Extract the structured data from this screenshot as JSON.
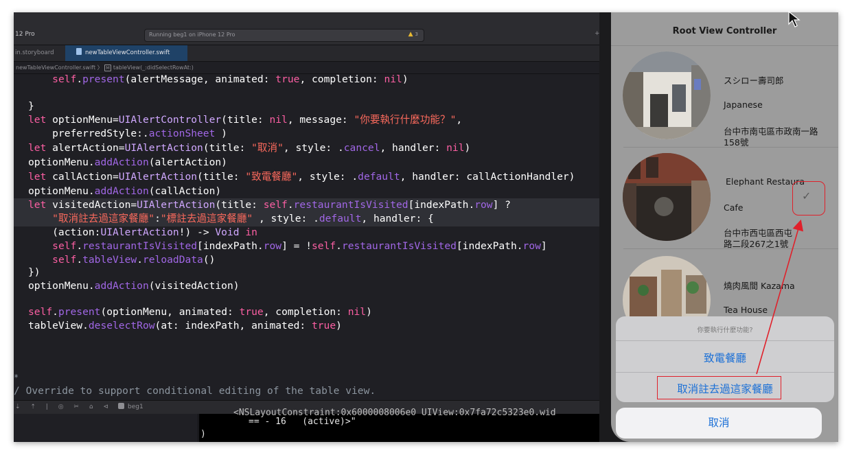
{
  "xcode": {
    "scheme": "12 Pro",
    "status": "Running beg1 on iPhone 12 Pro",
    "warning_count": "3",
    "add_label": "+",
    "tabs": [
      {
        "label": "in.storyboard"
      },
      {
        "label": "newTableViewController.swift"
      }
    ],
    "jumpbar": {
      "file": "newTableViewController.swift",
      "separator": "〉",
      "badge": "M",
      "method": "tableView(_:didSelectRowAt:)"
    },
    "gutter_mark": "*",
    "debug_target": "beg1",
    "debug_icons": "⇣ ⇡ | ◎ ✂ ⌂ ⊲",
    "console": {
      "clipped": "<NSLayoutConstraint:0x6000008006e0 UIView:0x7fa72c5323e0.wid",
      "line1": "== - 16   (active)>\"",
      "line2": ")"
    }
  },
  "simulator": {
    "nav_title": "Root View Controller",
    "rows": [
      {
        "name": "スシロー壽司郎",
        "type": "Japanese",
        "location": "台中市南屯區市政南一路158號"
      },
      {
        "name": "Elephant Restaura",
        "type": "Cafe",
        "location": "台中市西屯區西屯路二段267之1號",
        "checked": true
      },
      {
        "name": "燒肉風間 Kazama",
        "type": "Tea House",
        "location": ""
      }
    ],
    "checkmark": "✓",
    "action_sheet": {
      "message": "你要執行什麼功能?",
      "actions": [
        "致電餐廳",
        "取消註去過這家餐廳"
      ],
      "cancel": "取消"
    },
    "colors": {
      "highlight": "#e0202a",
      "tint": "#1a6fd6"
    }
  }
}
